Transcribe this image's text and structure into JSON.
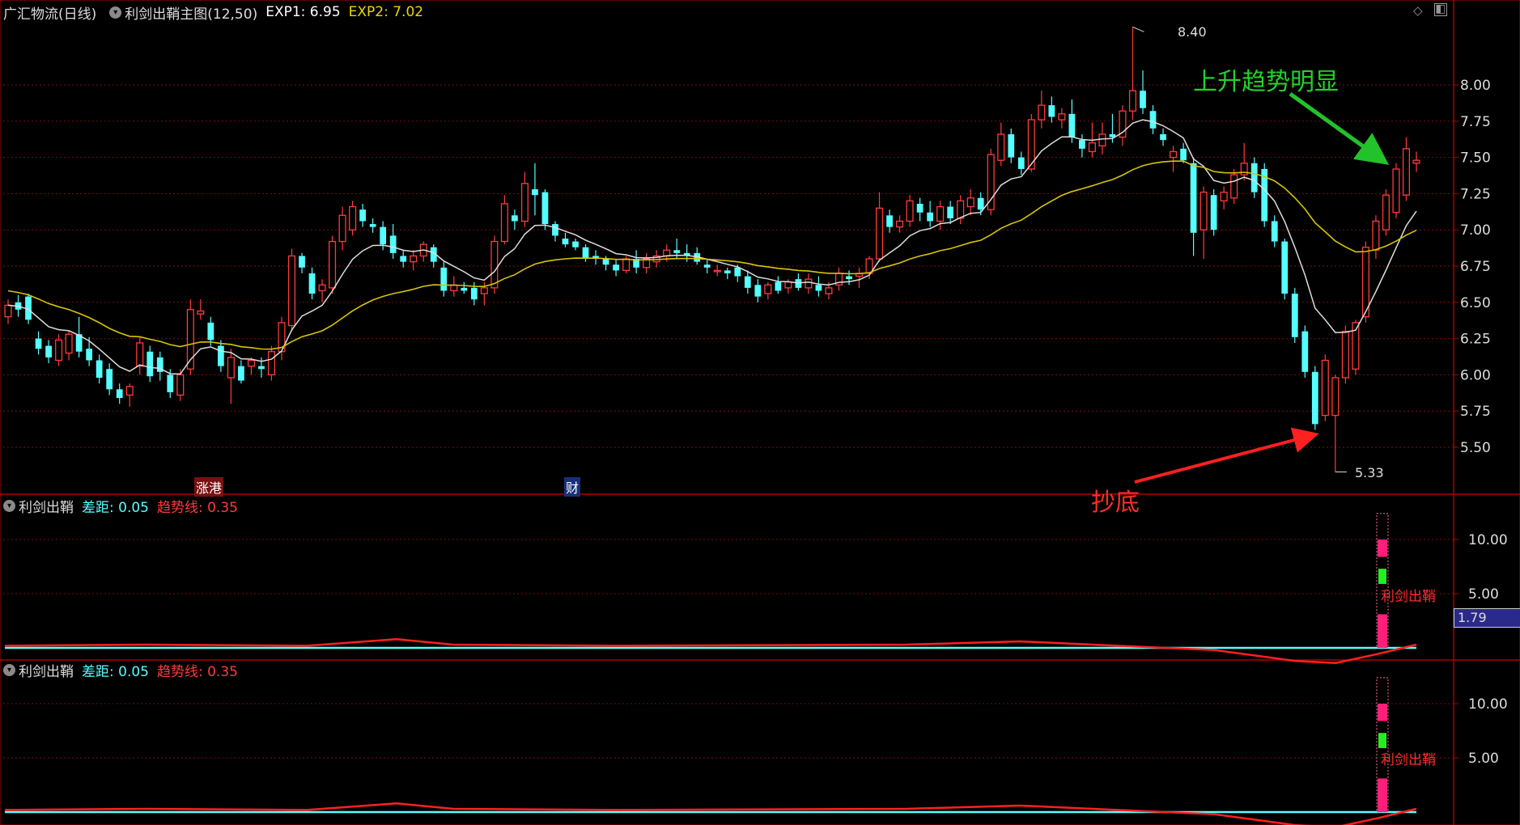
{
  "header": {
    "stock": "广汇物流(日线)",
    "indicator": "利剑出鞘主图(12,50)",
    "exp1_label": "EXP1: 6.95",
    "exp2_label": "EXP2: 7.02"
  },
  "sub1": {
    "name": "利剑出鞘",
    "diff": "差距: 0.05",
    "trend": "趋势线: 0.35",
    "signal_label": "利剑出鞘",
    "current": "1.79"
  },
  "sub2": {
    "name": "利剑出鞘",
    "diff": "差距: 0.05",
    "trend": "趋势线: 0.35",
    "signal_label": "利剑出鞘"
  },
  "annotations": {
    "up_trend": "上升趋势明显",
    "bottom_fish": "抄底",
    "high_label": "8.40",
    "low_label": "5.33",
    "tag_zhang": "涨港",
    "tag_cai": "财"
  },
  "colors": {
    "up": "#ff3b3b",
    "down": "#54ffff",
    "ma_short": "#dddddd",
    "ma_long": "#d8c400",
    "grid": "#7a1010",
    "axis": "#b00000"
  },
  "chart_data": {
    "type": "candlestick",
    "main": {
      "yticks": [
        8.0,
        7.75,
        7.5,
        7.25,
        7.0,
        6.75,
        6.5,
        6.25,
        6.0,
        5.75,
        5.5
      ],
      "ylim": [
        5.33,
        8.4
      ],
      "candles": [
        [
          6.4,
          6.52,
          6.35,
          6.48
        ],
        [
          6.5,
          6.55,
          6.4,
          6.45
        ],
        [
          6.54,
          6.56,
          6.35,
          6.38
        ],
        [
          6.25,
          6.3,
          6.14,
          6.18
        ],
        [
          6.2,
          6.24,
          6.08,
          6.12
        ],
        [
          6.1,
          6.28,
          6.06,
          6.24
        ],
        [
          6.15,
          6.3,
          6.1,
          6.28
        ],
        [
          6.28,
          6.4,
          6.12,
          6.16
        ],
        [
          6.18,
          6.26,
          6.06,
          6.1
        ],
        [
          6.1,
          6.14,
          5.94,
          5.98
        ],
        [
          6.04,
          6.08,
          5.86,
          5.9
        ],
        [
          5.9,
          5.94,
          5.8,
          5.84
        ],
        [
          5.86,
          5.94,
          5.78,
          5.92
        ],
        [
          6.06,
          6.26,
          6.0,
          6.22
        ],
        [
          6.16,
          6.2,
          5.95,
          5.99
        ],
        [
          6.12,
          6.16,
          5.96,
          6.02
        ],
        [
          6.0,
          6.04,
          5.84,
          5.88
        ],
        [
          5.86,
          6.04,
          5.82,
          6.0
        ],
        [
          6.04,
          6.52,
          6.0,
          6.45
        ],
        [
          6.42,
          6.52,
          6.38,
          6.44
        ],
        [
          6.36,
          6.4,
          6.2,
          6.24
        ],
        [
          6.2,
          6.24,
          6.02,
          6.06
        ],
        [
          5.98,
          6.18,
          5.8,
          6.12
        ],
        [
          6.06,
          6.1,
          5.94,
          5.96
        ],
        [
          6.06,
          6.12,
          6.0,
          6.1
        ],
        [
          6.06,
          6.12,
          5.98,
          6.04
        ],
        [
          6.0,
          6.2,
          5.96,
          6.16
        ],
        [
          6.16,
          6.4,
          6.1,
          6.36
        ],
        [
          6.34,
          6.87,
          6.3,
          6.82
        ],
        [
          6.82,
          6.84,
          6.7,
          6.74
        ],
        [
          6.7,
          6.74,
          6.52,
          6.56
        ],
        [
          6.58,
          6.66,
          6.5,
          6.62
        ],
        [
          6.6,
          6.96,
          6.56,
          6.92
        ],
        [
          6.92,
          7.16,
          6.86,
          7.1
        ],
        [
          7.0,
          7.2,
          6.96,
          7.16
        ],
        [
          7.14,
          7.18,
          7.02,
          7.06
        ],
        [
          7.04,
          7.08,
          6.98,
          7.02
        ],
        [
          7.02,
          7.06,
          6.86,
          6.9
        ],
        [
          6.96,
          7.04,
          6.8,
          6.84
        ],
        [
          6.82,
          6.86,
          6.74,
          6.78
        ],
        [
          6.78,
          6.86,
          6.72,
          6.82
        ],
        [
          6.82,
          6.92,
          6.78,
          6.9
        ],
        [
          6.88,
          6.9,
          6.74,
          6.78
        ],
        [
          6.74,
          6.78,
          6.54,
          6.58
        ],
        [
          6.58,
          6.68,
          6.54,
          6.62
        ],
        [
          6.6,
          6.64,
          6.56,
          6.58
        ],
        [
          6.6,
          6.64,
          6.48,
          6.52
        ],
        [
          6.56,
          6.64,
          6.48,
          6.6
        ],
        [
          6.6,
          6.96,
          6.56,
          6.92
        ],
        [
          6.92,
          7.24,
          6.9,
          7.18
        ],
        [
          7.1,
          7.14,
          7.0,
          7.06
        ],
        [
          7.06,
          7.4,
          7.02,
          7.32
        ],
        [
          7.28,
          7.46,
          7.1,
          7.24
        ],
        [
          7.26,
          7.28,
          7.0,
          7.04
        ],
        [
          7.04,
          7.06,
          6.92,
          6.96
        ],
        [
          6.94,
          6.98,
          6.88,
          6.9
        ],
        [
          6.92,
          6.94,
          6.86,
          6.88
        ],
        [
          6.88,
          6.9,
          6.78,
          6.8
        ],
        [
          6.82,
          6.86,
          6.76,
          6.8
        ],
        [
          6.8,
          6.82,
          6.72,
          6.76
        ],
        [
          6.76,
          6.8,
          6.68,
          6.72
        ],
        [
          6.72,
          6.82,
          6.7,
          6.8
        ],
        [
          6.8,
          6.86,
          6.7,
          6.74
        ],
        [
          6.74,
          6.84,
          6.7,
          6.8
        ],
        [
          6.78,
          6.86,
          6.74,
          6.82
        ],
        [
          6.82,
          6.9,
          6.78,
          6.86
        ],
        [
          6.86,
          6.94,
          6.8,
          6.84
        ],
        [
          6.84,
          6.9,
          6.78,
          6.82
        ],
        [
          6.84,
          6.88,
          6.76,
          6.78
        ],
        [
          6.76,
          6.8,
          6.7,
          6.74
        ],
        [
          6.72,
          6.76,
          6.68,
          6.72
        ],
        [
          6.72,
          6.74,
          6.66,
          6.7
        ],
        [
          6.74,
          6.76,
          6.64,
          6.68
        ],
        [
          6.68,
          6.72,
          6.56,
          6.6
        ],
        [
          6.62,
          6.66,
          6.5,
          6.54
        ],
        [
          6.56,
          6.64,
          6.52,
          6.62
        ],
        [
          6.64,
          6.68,
          6.56,
          6.58
        ],
        [
          6.6,
          6.66,
          6.56,
          6.64
        ],
        [
          6.66,
          6.7,
          6.58,
          6.6
        ],
        [
          6.6,
          6.7,
          6.56,
          6.66
        ],
        [
          6.62,
          6.68,
          6.54,
          6.58
        ],
        [
          6.56,
          6.64,
          6.52,
          6.6
        ],
        [
          6.62,
          6.74,
          6.58,
          6.7
        ],
        [
          6.68,
          6.72,
          6.62,
          6.66
        ],
        [
          6.68,
          6.74,
          6.6,
          6.7
        ],
        [
          6.7,
          6.82,
          6.66,
          6.8
        ],
        [
          6.8,
          7.26,
          6.78,
          7.15
        ],
        [
          7.1,
          7.14,
          6.98,
          7.02
        ],
        [
          7.02,
          7.1,
          6.98,
          7.06
        ],
        [
          7.06,
          7.24,
          7.02,
          7.2
        ],
        [
          7.18,
          7.22,
          7.06,
          7.12
        ],
        [
          7.12,
          7.2,
          7.02,
          7.06
        ],
        [
          7.06,
          7.2,
          7.0,
          7.16
        ],
        [
          7.16,
          7.2,
          7.04,
          7.08
        ],
        [
          7.08,
          7.24,
          7.04,
          7.2
        ],
        [
          7.16,
          7.28,
          7.1,
          7.22
        ],
        [
          7.22,
          7.26,
          7.1,
          7.14
        ],
        [
          7.14,
          7.56,
          7.1,
          7.52
        ],
        [
          7.48,
          7.74,
          7.44,
          7.66
        ],
        [
          7.66,
          7.7,
          7.46,
          7.5
        ],
        [
          7.5,
          7.54,
          7.38,
          7.42
        ],
        [
          7.42,
          7.8,
          7.4,
          7.76
        ],
        [
          7.76,
          7.96,
          7.7,
          7.86
        ],
        [
          7.86,
          7.92,
          7.74,
          7.78
        ],
        [
          7.76,
          7.84,
          7.7,
          7.8
        ],
        [
          7.8,
          7.9,
          7.6,
          7.64
        ],
        [
          7.62,
          7.66,
          7.5,
          7.56
        ],
        [
          7.54,
          7.74,
          7.5,
          7.6
        ],
        [
          7.58,
          7.74,
          7.52,
          7.66
        ],
        [
          7.66,
          7.8,
          7.6,
          7.64
        ],
        [
          7.64,
          7.86,
          7.58,
          7.82
        ],
        [
          7.82,
          8.4,
          7.76,
          7.96
        ],
        [
          7.96,
          8.1,
          7.8,
          7.84
        ],
        [
          7.82,
          7.86,
          7.66,
          7.7
        ],
        [
          7.66,
          7.7,
          7.58,
          7.62
        ],
        [
          7.5,
          7.58,
          7.4,
          7.54
        ],
        [
          7.56,
          7.6,
          7.46,
          7.48
        ],
        [
          7.46,
          7.5,
          6.82,
          6.98
        ],
        [
          7.0,
          7.3,
          6.8,
          7.26
        ],
        [
          7.24,
          7.28,
          6.96,
          7.0
        ],
        [
          7.2,
          7.3,
          7.14,
          7.26
        ],
        [
          7.22,
          7.42,
          7.18,
          7.38
        ],
        [
          7.38,
          7.6,
          7.34,
          7.46
        ],
        [
          7.46,
          7.5,
          7.22,
          7.26
        ],
        [
          7.42,
          7.46,
          7.02,
          7.06
        ],
        [
          7.06,
          7.1,
          6.88,
          6.92
        ],
        [
          6.92,
          6.94,
          6.52,
          6.56
        ],
        [
          6.56,
          6.6,
          6.22,
          6.26
        ],
        [
          6.3,
          6.34,
          5.98,
          6.02
        ],
        [
          6.02,
          6.06,
          5.62,
          5.66
        ],
        [
          5.72,
          6.14,
          5.68,
          6.1
        ],
        [
          5.72,
          6.0,
          5.33,
          5.98
        ],
        [
          5.98,
          6.34,
          5.94,
          6.3
        ],
        [
          6.04,
          6.38,
          6.0,
          6.36
        ],
        [
          6.4,
          6.92,
          6.36,
          6.88
        ],
        [
          6.86,
          7.1,
          6.8,
          7.06
        ],
        [
          7.0,
          7.28,
          6.96,
          7.24
        ],
        [
          7.12,
          7.46,
          7.08,
          7.42
        ],
        [
          7.24,
          7.64,
          7.2,
          7.56
        ],
        [
          7.46,
          7.54,
          7.4,
          7.48
        ]
      ],
      "ma_short_name": "EXP1",
      "ma_long_name": "EXP2"
    },
    "sub": {
      "yticks": [
        10.0,
        5.0
      ],
      "ylim": [
        0,
        13
      ]
    }
  }
}
